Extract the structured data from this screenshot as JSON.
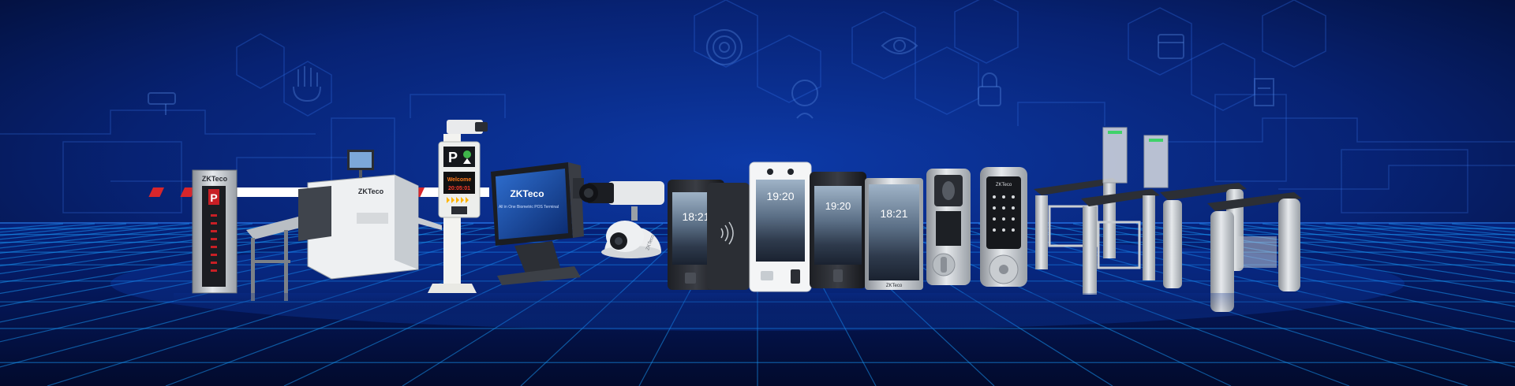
{
  "brand": {
    "barrier_logo": "ZKTeco",
    "xray_logo": "ZKTeco",
    "pos_logo": "ZKTeco",
    "pos_caption": "All in One Biometric POS Terminal",
    "camera_logo": "ZKTeco",
    "panel_logo": "ZKTeco",
    "lock_logo": "ZKTeco"
  },
  "parking": {
    "p_sign": "P",
    "welcome": "Welcome",
    "time": "20:05:01"
  },
  "terminals": {
    "clock_1": "18:21",
    "clock_2": "19:20",
    "clock_3": "19:20",
    "clock_4": "18:21"
  },
  "colors": {
    "background_dark": "#020b2e",
    "background_mid": "#0a2c8a",
    "grid_line": "#1aa0ff",
    "brand_green": "#8dc63f",
    "barrier_red": "#d8262b"
  }
}
